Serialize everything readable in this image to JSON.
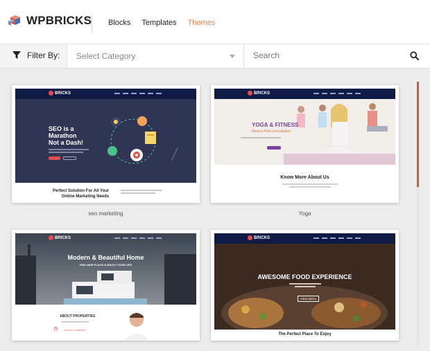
{
  "header": {
    "logo_text": "WPBRICKS",
    "nav": [
      {
        "label": "Blocks",
        "active": false
      },
      {
        "label": "Templates",
        "active": false
      },
      {
        "label": "Themes",
        "active": true
      }
    ],
    "active_color": "#e97e4f"
  },
  "filter": {
    "label": "Filter By:",
    "select_placeholder": "Select Category",
    "search_placeholder": "Search"
  },
  "cards": [
    {
      "caption": "seo marketing",
      "hero_title_1": "SEO is a",
      "hero_title_2": "Marathon",
      "hero_title_3": "Not a Dash!",
      "footer_text_1": "Perfect Solution For All Your",
      "footer_text_2": "Online Marketing Needs"
    },
    {
      "caption": "Yoga",
      "hero_title": "YOGA & FITNESS",
      "hero_sub": "Need a Free consultation",
      "section_title": "Know More About Us"
    },
    {
      "caption": "",
      "hero_title": "Modern & Beautiful Home",
      "hero_sub": "FIND NEW PLACE & ENJOY YOUR LIFE",
      "section_title": "ABOUT PROPERTIES",
      "section_sub": "Various Locations"
    },
    {
      "caption": "",
      "hero_title": "AWESOME FOOD EXPERIENCE",
      "section_title": "The Perfect Place To Enjoy",
      "btn_label": "VIEW MENU"
    }
  ],
  "brand_label": "BRICKS",
  "colors": {
    "nav_dark": "#0f1a45",
    "scroll_accent": "#d4593a",
    "seo_bg": "#2f3552",
    "yoga_accent": "#7b3fa0"
  }
}
